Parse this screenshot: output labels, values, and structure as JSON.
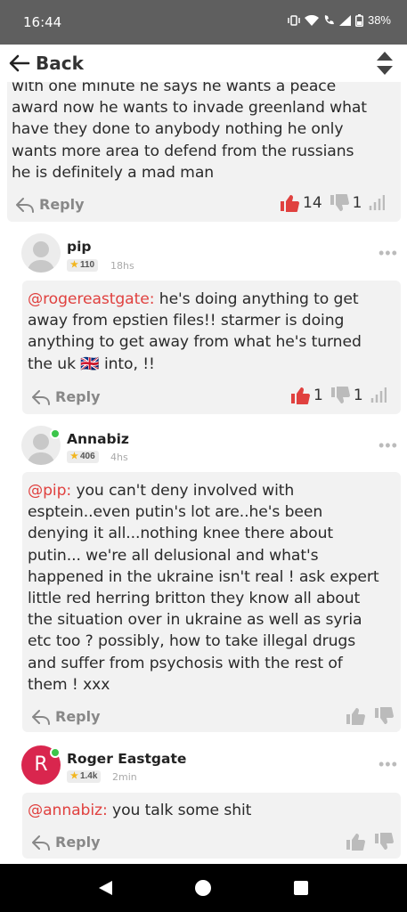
{
  "status_bar": {
    "time": "16:44",
    "battery": "38%"
  },
  "header": {
    "back_label": "Back"
  },
  "reply_label": "Reply",
  "comments": [
    {
      "lines": [
        "with one minute he says he wants a peace",
        "award now he wants to invade greenland what",
        "have they done to anybody nothing he only",
        "wants more area to defend from the russians",
        "he is definitely a mad man"
      ],
      "likes": "14",
      "dislikes": "1"
    },
    {
      "username": "pip",
      "badge": "110",
      "time": "18hs",
      "mention": "@rogereastgate:",
      "lines": [
        " he's doing anything to get",
        "away from epstien files!! starmer is doing",
        "anything to get away from what he's turned",
        "the uk 🇬🇧 into, !!"
      ],
      "likes": "1",
      "dislikes": "1"
    },
    {
      "username": "Annabiz",
      "badge": "406",
      "time": "4hs",
      "mention": "@pip:",
      "lines": [
        " you can't deny involved with",
        "esptein..even putin's lot are..he's been",
        "denying it all...nothing knee there about",
        "putin... we're all delusional and what's",
        "happened in the ukraine isn't real ! ask expert",
        "little red herring britton they know all about",
        "the situation over in ukraine as well as syria",
        "etc too ? possibly, how to take illegal drugs",
        "and suffer from psychosis with the rest of",
        "them ! xxx"
      ]
    },
    {
      "username": "Roger Eastgate",
      "avatar_letter": "R",
      "badge": "1.4k",
      "time": "2min",
      "mention": "@annabiz:",
      "lines": [
        " you talk some shit"
      ]
    }
  ],
  "colors": {
    "mention": "#e0413f",
    "like_active": "#e0413f",
    "online": "#3cc54b",
    "avatar_r": "#d9264e"
  }
}
